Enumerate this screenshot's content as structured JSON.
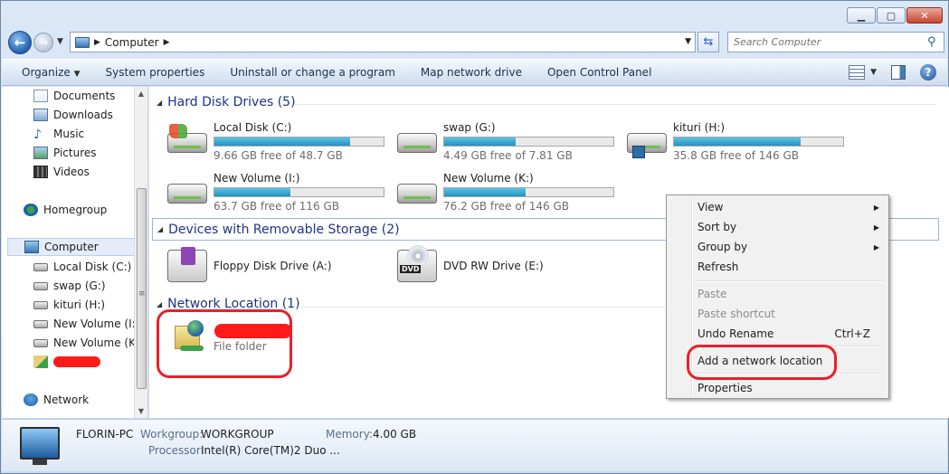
{
  "address": {
    "crumb": "Computer"
  },
  "search": {
    "placeholder": "Search Computer"
  },
  "toolbar": {
    "organize": "Organize",
    "system_properties": "System properties",
    "uninstall": "Uninstall or change a program",
    "map_drive": "Map network drive",
    "control_panel": "Open Control Panel"
  },
  "navpane": {
    "libraries": [
      "Documents",
      "Downloads",
      "Music",
      "Pictures",
      "Videos"
    ],
    "homegroup": "Homegroup",
    "computer": "Computer",
    "drives": [
      "Local Disk (C:)",
      "swap (G:)",
      "kituri (H:)",
      "New Volume (I:)",
      "New Volume (K:)"
    ],
    "network": "Network"
  },
  "groups": {
    "hdd": "Hard Disk Drives (5)",
    "removable": "Devices with Removable Storage (2)",
    "network": "Network Location (1)"
  },
  "drives": [
    {
      "name": "Local Disk (C:)",
      "free": "9.66 GB free of 48.7 GB",
      "used_fraction": 0.8
    },
    {
      "name": "swap (G:)",
      "free": "4.49 GB free of 7.81 GB",
      "used_fraction": 0.42
    },
    {
      "name": "kituri (H:)",
      "free": "35.8 GB free of 146 GB",
      "used_fraction": 0.75
    },
    {
      "name": "New Volume (I:)",
      "free": "63.7 GB free of 116 GB",
      "used_fraction": 0.45
    },
    {
      "name": "New Volume (K:)",
      "free": "76.2 GB free of 146 GB",
      "used_fraction": 0.48
    }
  ],
  "devices": [
    {
      "name": "Floppy Disk Drive (A:)"
    },
    {
      "name": "DVD RW Drive (E:)",
      "badge": "DVD"
    }
  ],
  "network_location": {
    "type": "File folder"
  },
  "context_menu": {
    "view": "View",
    "sort_by": "Sort by",
    "group_by": "Group by",
    "refresh": "Refresh",
    "paste": "Paste",
    "paste_shortcut": "Paste shortcut",
    "undo_rename": "Undo Rename",
    "undo_shortcut": "Ctrl+Z",
    "add_network_location": "Add a network location",
    "properties": "Properties"
  },
  "details": {
    "pc_name": "FLORIN-PC",
    "workgroup_label": "Workgroup:",
    "workgroup": "WORKGROUP",
    "memory_label": "Memory:",
    "memory": "4.00 GB",
    "processor_label": "Processor:",
    "processor": "Intel(R) Core(TM)2 Duo ..."
  },
  "colors": {
    "accent": "#1e3287",
    "bar_fill": "#26a0da",
    "highlight_circle": "#e8212b",
    "redaction": "#ff1a1a"
  }
}
